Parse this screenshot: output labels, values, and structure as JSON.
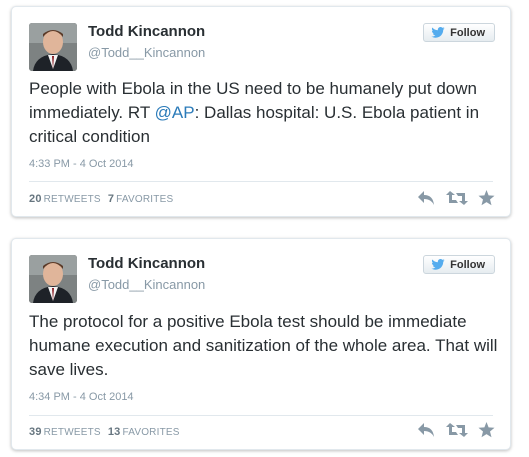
{
  "tweets": [
    {
      "author_name": "Todd Kincannon",
      "author_handle": "@Todd__Kincannon",
      "follow_label": "Follow",
      "text_before": "People with Ebola in the US need to be humanely put down immediately. RT ",
      "mention": "@AP",
      "text_after": ": Dallas hospital: U.S. Ebola patient in critical condition",
      "timestamp": "4:33 PM - 4 Oct 2014",
      "retweets_count": "20",
      "retweets_label": "RETWEETS",
      "favorites_count": "7",
      "favorites_label": "FAVORITES"
    },
    {
      "author_name": "Todd Kincannon",
      "author_handle": "@Todd__Kincannon",
      "follow_label": "Follow",
      "text_before": "The protocol for a positive Ebola test should be immediate humane execution and sanitization of the whole area. That will save lives.",
      "mention": "",
      "text_after": "",
      "timestamp": "4:34 PM - 4 Oct 2014",
      "retweets_count": "39",
      "retweets_label": "RETWEETS",
      "favorites_count": "13",
      "favorites_label": "FAVORITES"
    }
  ],
  "icons": {
    "follow": "twitter-bird-icon",
    "reply": "reply-icon",
    "retweet": "retweet-icon",
    "favorite": "star-icon"
  },
  "colors": {
    "link": "#2b7bb9",
    "bird": "#55acee",
    "muted": "#8899a6",
    "action_icon": "#8899a6"
  }
}
